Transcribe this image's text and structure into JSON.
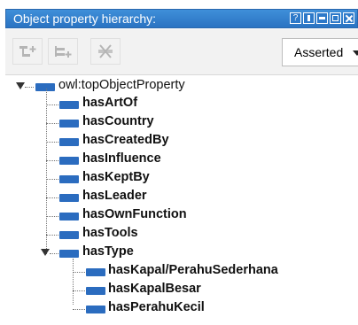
{
  "panel": {
    "title": "Object property hierarchy:",
    "window_buttons": [
      "?",
      "pin",
      "minimize",
      "maximize",
      "close"
    ]
  },
  "toolbar": {
    "buttons": [
      "add-sub-property-icon",
      "add-sibling-property-icon",
      "delete-property-icon"
    ],
    "mode_select": {
      "selected": "Asserted"
    }
  },
  "tree": {
    "root": {
      "label": "owl:topObjectProperty",
      "expanded": true
    },
    "children": [
      {
        "label": "hasArtOf"
      },
      {
        "label": "hasCountry"
      },
      {
        "label": "hasCreatedBy"
      },
      {
        "label": "hasInfluence"
      },
      {
        "label": "hasKeptBy"
      },
      {
        "label": "hasLeader"
      },
      {
        "label": "hasOwnFunction"
      },
      {
        "label": "hasTools"
      },
      {
        "label": "hasType",
        "expanded": true
      }
    ],
    "grandchildren": [
      {
        "label": "hasKapal/PerahuSederhana"
      },
      {
        "label": "hasKapalBesar"
      },
      {
        "label": "hasPerahuKecil"
      }
    ]
  },
  "colors": {
    "title_bar": "#2a73c2",
    "property_icon": "#2b6cbf"
  }
}
